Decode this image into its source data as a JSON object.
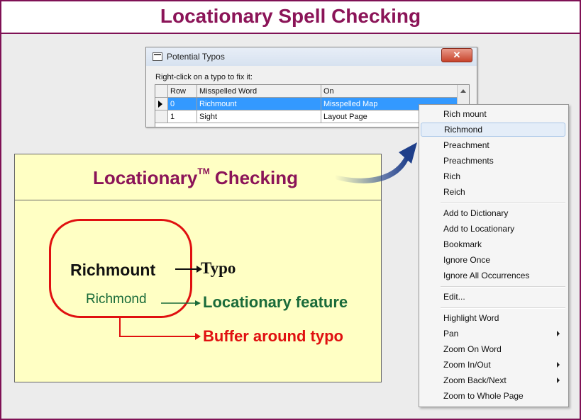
{
  "page": {
    "title": "Locationary Spell Checking"
  },
  "dialog": {
    "title": "Potential Typos",
    "close_label": "✕",
    "instruction": "Right-click on a typo to fix it:",
    "columns": [
      "Row",
      "Misspelled Word",
      "On"
    ],
    "rows": [
      {
        "row": "0",
        "word": "Richmount",
        "on": "Misspelled Map",
        "selected": true
      },
      {
        "row": "1",
        "word": "Sight",
        "on": "Layout Page",
        "selected": false
      }
    ]
  },
  "slide": {
    "title": "Locationary",
    "trademark": "TM",
    "title_suffix": " Checking",
    "typo_word": "Richmount",
    "typo_label": "Typo",
    "feature_word": "Richmond",
    "feature_label": "Locationary feature",
    "buffer_label": "Buffer around typo"
  },
  "context_menu": {
    "suggestions": [
      "Rich mount",
      "Richmond",
      "Preachment",
      "Preachments",
      "Rich",
      "Reich"
    ],
    "highlighted": "Richmond",
    "actions": [
      "Add to Dictionary",
      "Add to Locationary",
      "Bookmark",
      "Ignore Once",
      "Ignore All Occurrences"
    ],
    "edit": "Edit...",
    "view": [
      "Highlight Word",
      "Pan",
      "Zoom On Word",
      "Zoom In/Out",
      "Zoom Back/Next",
      "Zoom to Whole Page"
    ],
    "submenu_items": [
      "Pan",
      "Zoom In/Out",
      "Zoom Back/Next"
    ]
  },
  "colors": {
    "brand": "#8b1458",
    "typo_red": "#e01010",
    "feature_green": "#1a6b3a",
    "selection_blue": "#3399ff"
  }
}
